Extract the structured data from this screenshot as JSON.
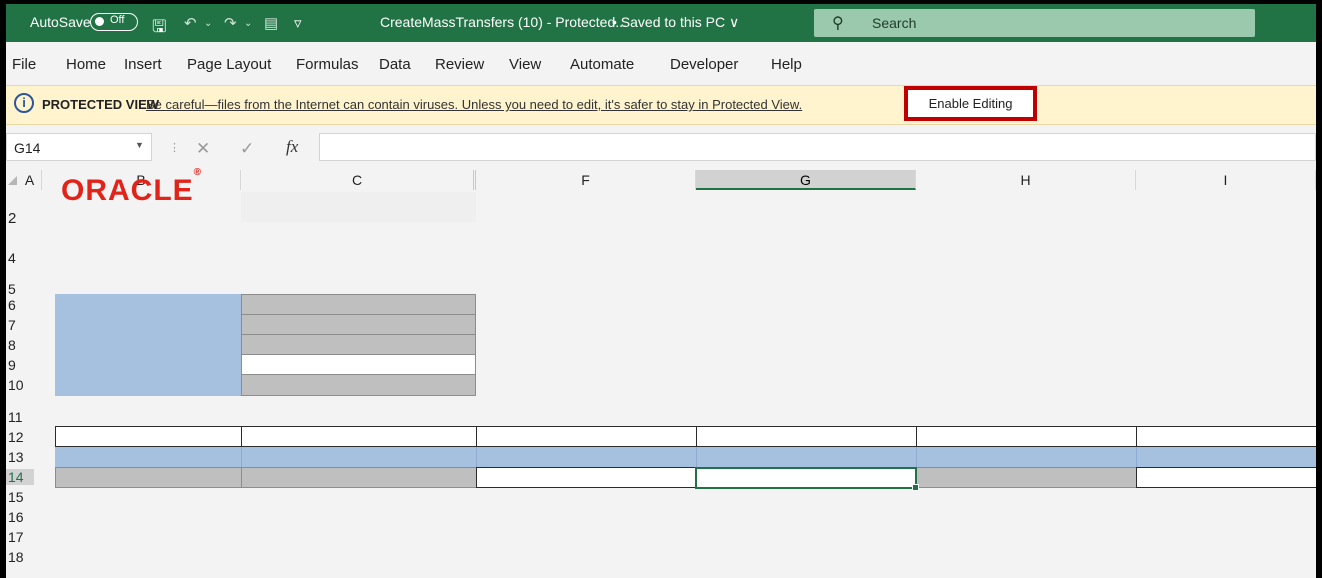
{
  "titlebar": {
    "autosave_label": "AutoSave",
    "autosave_state": "Off",
    "filename": "CreateMassTransfers (10)  -  Protected...",
    "saved_status": "• Saved to this PC ∨",
    "search_placeholder": "Search",
    "accent_color": "#217346"
  },
  "menu": {
    "items": [
      "File",
      "Home",
      "Insert",
      "Page Layout",
      "Formulas",
      "Data",
      "Review",
      "View",
      "Automate",
      "Developer",
      "Help"
    ]
  },
  "message_bar": {
    "title": "PROTECTED VIEW",
    "message": "Be careful—files from the Internet can contain viruses. Unless you need to edit, it's safer to stay in Protected View.",
    "button_label": "Enable Editing"
  },
  "formula_bar": {
    "name_box": "G14",
    "formula": "",
    "cancel_icon": "✕",
    "enter_icon": "✓",
    "fx_label": "fx"
  },
  "sheet": {
    "columns": [
      "A",
      "B",
      "C",
      "F",
      "G",
      "H",
      "I"
    ],
    "selected_column": "G",
    "rows": [
      "2",
      "4",
      "5",
      "6",
      "7",
      "8",
      "9",
      "10",
      "11",
      "12",
      "13",
      "14",
      "15",
      "16",
      "17",
      "18"
    ],
    "selected_row": "14",
    "logo_text": "ORACLE",
    "logo_mark": "®",
    "logo_color": "#e2231a",
    "header_fill": "#a6c1e0",
    "locked_fill": "#bfbfbf"
  }
}
